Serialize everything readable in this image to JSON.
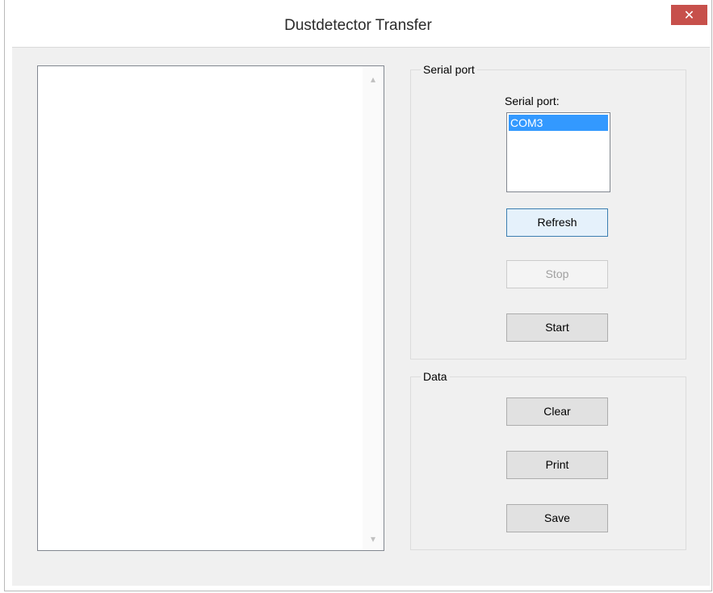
{
  "window": {
    "title": "Dustdetector Transfer",
    "close_glyph": "✕"
  },
  "output": {
    "text": "",
    "scroll_up_glyph": "▴",
    "scroll_down_glyph": "▾"
  },
  "serial_group": {
    "title": "Serial port",
    "list_label": "Serial port:",
    "ports": [
      "COM3"
    ],
    "selected_port": "COM3",
    "refresh_label": "Refresh",
    "stop_label": "Stop",
    "start_label": "Start"
  },
  "data_group": {
    "title": "Data",
    "clear_label": "Clear",
    "print_label": "Print",
    "save_label": "Save"
  },
  "colors": {
    "close_button": "#c7504b",
    "selection": "#3399ff",
    "focus_border": "#3c7fb1"
  }
}
